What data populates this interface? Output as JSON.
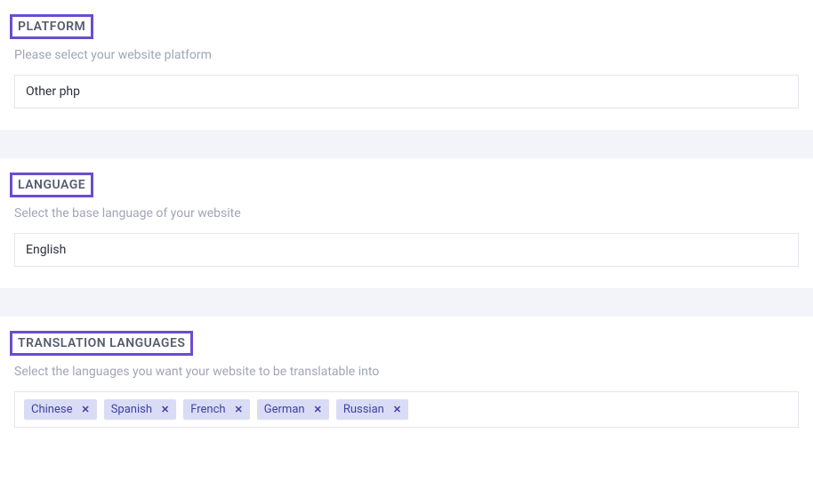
{
  "platform": {
    "title": "PLATFORM",
    "description": "Please select your website platform",
    "value": "Other php"
  },
  "language": {
    "title": "LANGUAGE",
    "description": "Select the base language of your website",
    "value": "English"
  },
  "translation_languages": {
    "title": "TRANSLATION LANGUAGES",
    "description": "Select the languages you want your website to be translatable into",
    "tags": [
      "Chinese",
      "Spanish",
      "French",
      "German",
      "Russian"
    ]
  }
}
